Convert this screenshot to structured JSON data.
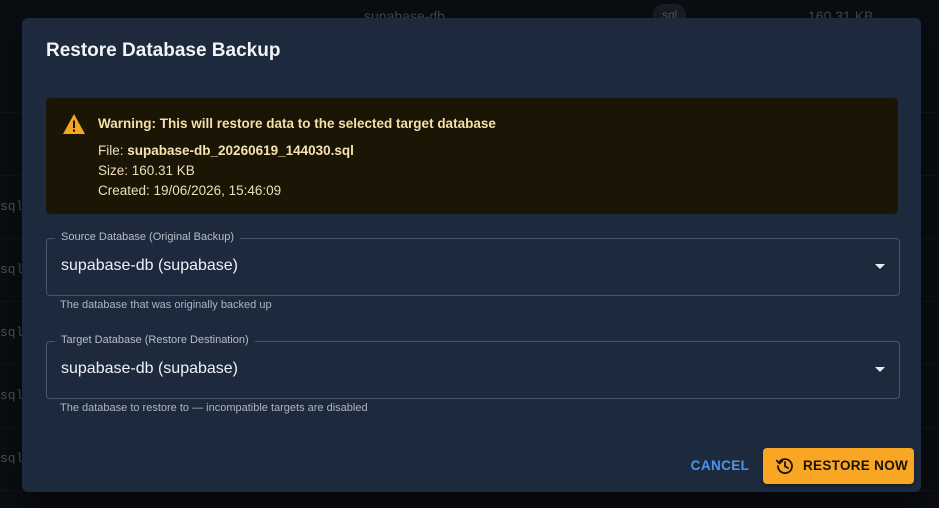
{
  "background": {
    "top_row": {
      "name": "supabase-db",
      "type_chip": "sql",
      "size": "160.31 KB"
    },
    "row_type_text": "sql"
  },
  "dialog": {
    "title": "Restore Database Backup",
    "warning": {
      "heading": "Warning: This will restore data to the selected target database",
      "file_label": "File: ",
      "file_value": "supabase-db_20260619_144030.sql",
      "size_line": "Size: 160.31 KB",
      "created_line": "Created: 19/06/2026, 15:46:09",
      "icon": "warning-triangle-icon"
    },
    "source": {
      "label": "Source Database (Original Backup)",
      "value": "supabase-db (supabase)",
      "helper": "The database that was originally backed up"
    },
    "target": {
      "label": "Target Database (Restore Destination)",
      "value": "supabase-db (supabase)",
      "helper": "The database to restore to — incompatible targets are disabled"
    },
    "actions": {
      "cancel_label": "CANCEL",
      "restore_label": "RESTORE NOW",
      "restore_icon": "history-icon"
    }
  },
  "colors": {
    "dialog_bg": "#1d2a3d",
    "warning_bg": "#1b1506",
    "warning_accent": "#f5a623",
    "primary_button": "#f8a623",
    "link": "#4c95e8"
  }
}
